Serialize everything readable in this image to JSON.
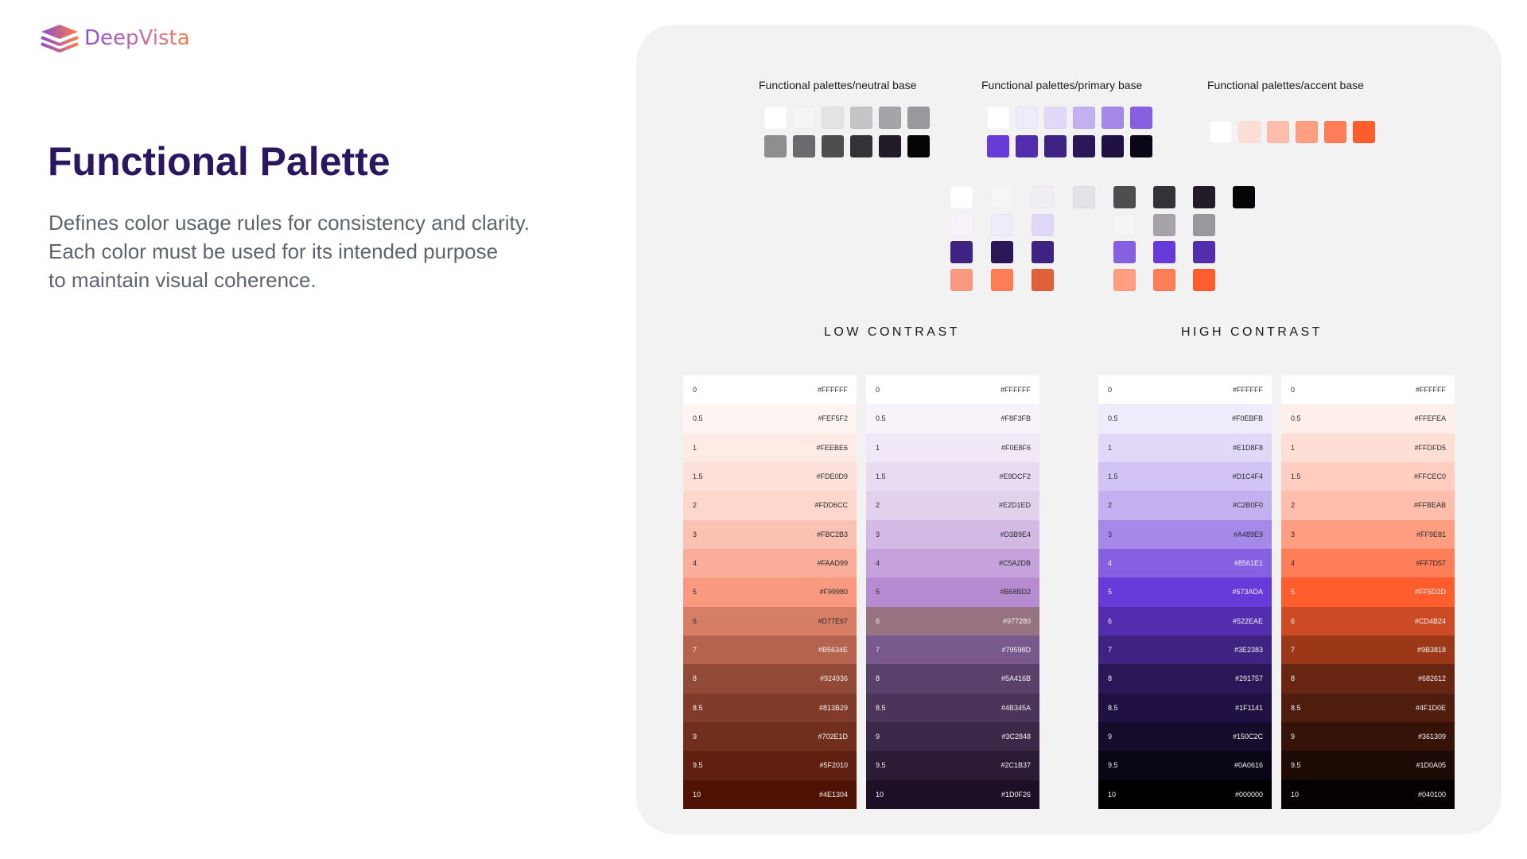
{
  "brand": {
    "name": "DeepVista",
    "gradient": [
      "#8a4fd0",
      "#ff7a4a"
    ]
  },
  "title": "Functional Palette",
  "description": [
    "Defines color usage rules for consistency and clarity.",
    "Each color must be used for its intended purpose",
    "to maintain visual coherence."
  ],
  "functional_palettes": [
    {
      "label": "Functional palettes/neutral base",
      "rows": [
        [
          "#ffffff",
          "#f5f5f5",
          "#e3e3e3",
          "#c7c4c7",
          "#a6a4a8",
          "#9a989c"
        ],
        [
          "#8e8d90",
          "#6b6a6e",
          "#4e4d50",
          "#333236",
          "#231b27",
          "#050406"
        ]
      ]
    },
    {
      "label": "Functional palettes/primary base",
      "rows": [
        [
          "#ffffff",
          "#f0ebfb",
          "#e1d8f8",
          "#c2b0f0",
          "#a489e9",
          "#8561e1"
        ],
        [
          "#673ada",
          "#522eae",
          "#3e2383",
          "#291757",
          "#1f1141",
          "#0a0616"
        ]
      ]
    },
    {
      "label": "Functional palettes/accent base",
      "rows": [
        [
          "#ffffff",
          "#ffdfd5",
          "#ffbeab",
          "#ff9e81",
          "#ff7d57",
          "#ff5d2d"
        ]
      ]
    }
  ],
  "mixed_swatches": [
    [
      "#ffffff",
      "#f7f6f7",
      "#f0eef2",
      "#e3e2e6",
      "#4e4d50",
      "#333236",
      "#231b27",
      "#050406"
    ],
    [
      "#f8f3fb",
      "#f0ebfb",
      "#e1d8f8",
      "",
      "#f5f5f5",
      "#a6a4a8",
      "#9a989c",
      ""
    ],
    [
      "#3e2383",
      "#291757",
      "#3e2383",
      "",
      "#8561e1",
      "#673ada",
      "#522eae",
      ""
    ],
    [
      "#f99980",
      "#ff7d57",
      "#e0623a",
      "",
      "#ff9e81",
      "#ff7d57",
      "#ff5d2d",
      ""
    ]
  ],
  "low_contrast": {
    "title": "LOW CONTRAST",
    "columns": [
      [
        {
          "step": "0",
          "hex": "#FFFFFF"
        },
        {
          "step": "0.5",
          "hex": "#FEF5F2"
        },
        {
          "step": "1",
          "hex": "#FEEBE6"
        },
        {
          "step": "1.5",
          "hex": "#FDE0D9"
        },
        {
          "step": "2",
          "hex": "#FDD6CC"
        },
        {
          "step": "3",
          "hex": "#FBC2B3"
        },
        {
          "step": "4",
          "hex": "#FAAD99"
        },
        {
          "step": "5",
          "hex": "#F99980"
        },
        {
          "step": "6",
          "hex": "#D77E67"
        },
        {
          "step": "7",
          "hex": "#B5634E"
        },
        {
          "step": "8",
          "hex": "#924936"
        },
        {
          "step": "8.5",
          "hex": "#813B29"
        },
        {
          "step": "9",
          "hex": "#702E1D"
        },
        {
          "step": "9.5",
          "hex": "#5F2010"
        },
        {
          "step": "10",
          "hex": "#4E1304"
        }
      ],
      [
        {
          "step": "0",
          "hex": "#FFFFFF"
        },
        {
          "step": "0.5",
          "hex": "#F8F3FB"
        },
        {
          "step": "1",
          "hex": "#F0E8F6"
        },
        {
          "step": "1.5",
          "hex": "#E9DCF2"
        },
        {
          "step": "2",
          "hex": "#E2D1ED"
        },
        {
          "step": "3",
          "hex": "#D3B9E4"
        },
        {
          "step": "4",
          "hex": "#C5A2DB"
        },
        {
          "step": "5",
          "hex": "#B68BD2"
        },
        {
          "step": "6",
          "hex": "#977280"
        },
        {
          "step": "7",
          "hex": "#79598D"
        },
        {
          "step": "8",
          "hex": "#5A416B"
        },
        {
          "step": "8.5",
          "hex": "#4B345A"
        },
        {
          "step": "9",
          "hex": "#3C2848"
        },
        {
          "step": "9.5",
          "hex": "#2C1B37"
        },
        {
          "step": "10",
          "hex": "#1D0F26"
        }
      ]
    ]
  },
  "high_contrast": {
    "title": "HIGH CONTRAST",
    "columns": [
      [
        {
          "step": "0",
          "hex": "#FFFFFF"
        },
        {
          "step": "0.5",
          "hex": "#F0EBFB"
        },
        {
          "step": "1",
          "hex": "#E1D8F8"
        },
        {
          "step": "1.5",
          "hex": "#D1C4F4"
        },
        {
          "step": "2",
          "hex": "#C2B0F0"
        },
        {
          "step": "3",
          "hex": "#A489E9"
        },
        {
          "step": "4",
          "hex": "#8561E1"
        },
        {
          "step": "5",
          "hex": "#673ADA"
        },
        {
          "step": "6",
          "hex": "#522EAE"
        },
        {
          "step": "7",
          "hex": "#3E2383"
        },
        {
          "step": "8",
          "hex": "#291757"
        },
        {
          "step": "8.5",
          "hex": "#1F1141"
        },
        {
          "step": "9",
          "hex": "#150C2C"
        },
        {
          "step": "9.5",
          "hex": "#0A0616"
        },
        {
          "step": "10",
          "hex": "#000000"
        }
      ],
      [
        {
          "step": "0",
          "hex": "#FFFFFF"
        },
        {
          "step": "0.5",
          "hex": "#FFEFEA"
        },
        {
          "step": "1",
          "hex": "#FFDFD5"
        },
        {
          "step": "1.5",
          "hex": "#FFCEC0"
        },
        {
          "step": "2",
          "hex": "#FFBEAB"
        },
        {
          "step": "3",
          "hex": "#FF9E81"
        },
        {
          "step": "4",
          "hex": "#FF7D57"
        },
        {
          "step": "5",
          "hex": "#FF5D2D"
        },
        {
          "step": "6",
          "hex": "#CD4B24"
        },
        {
          "step": "7",
          "hex": "#9B3818"
        },
        {
          "step": "8",
          "hex": "#682612"
        },
        {
          "step": "8.5",
          "hex": "#4F1D0E"
        },
        {
          "step": "9",
          "hex": "#361309"
        },
        {
          "step": "9.5",
          "hex": "#1D0A05"
        },
        {
          "step": "10",
          "hex": "#040100"
        }
      ]
    ]
  }
}
